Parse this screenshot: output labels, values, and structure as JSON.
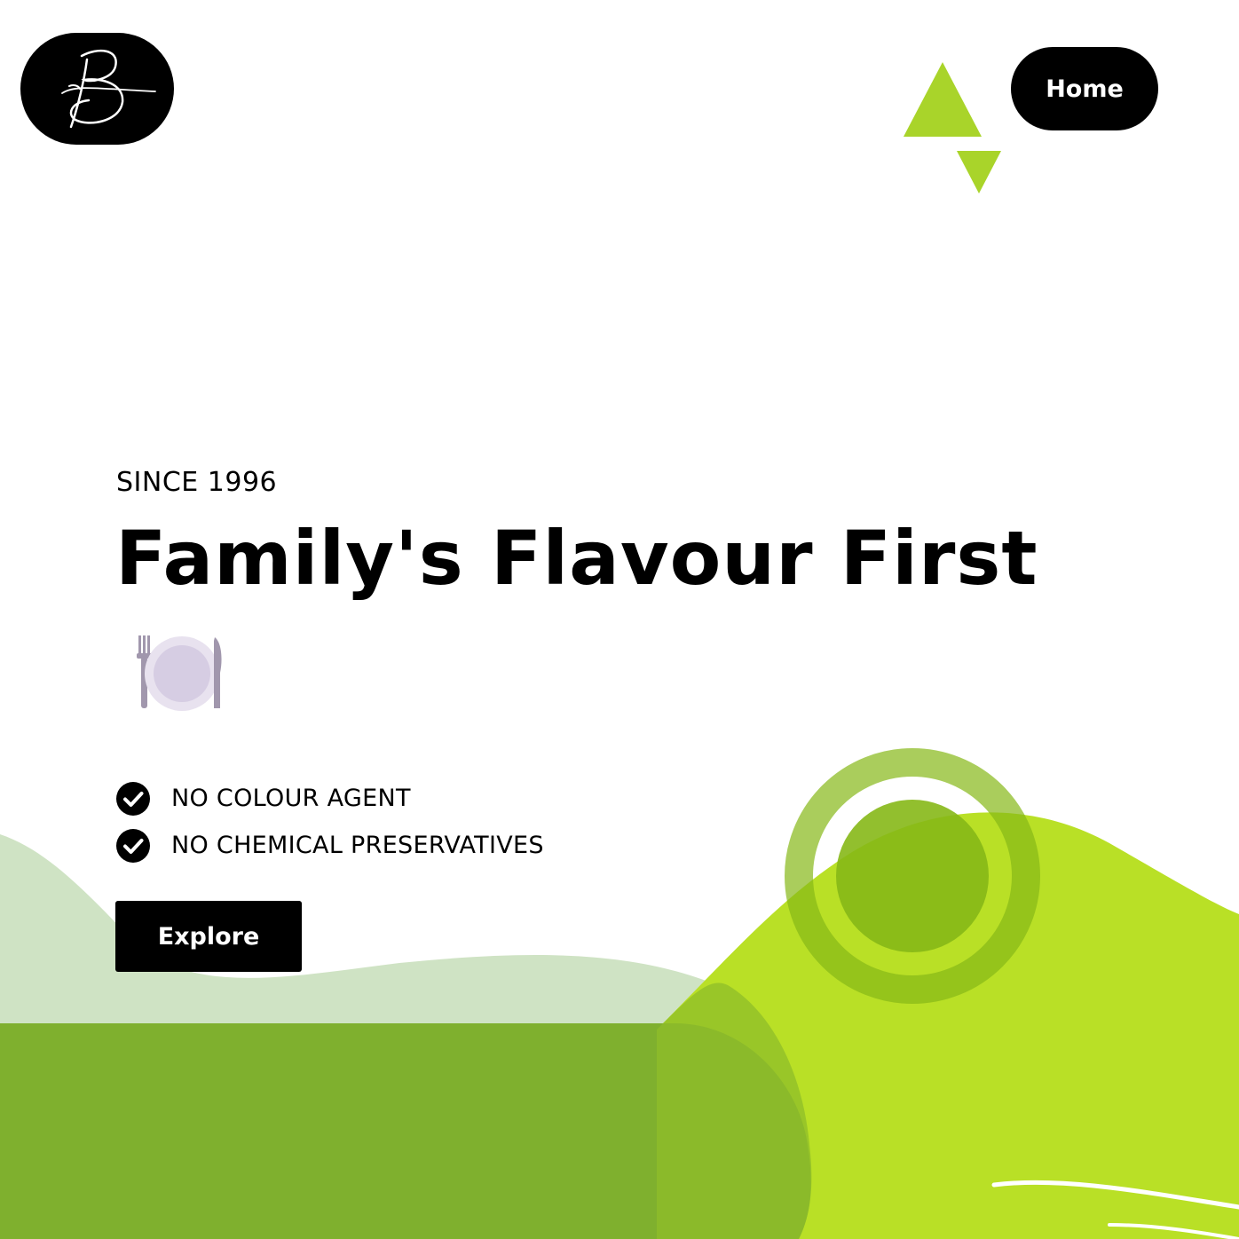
{
  "header": {
    "logo_icon": "signature-b-logo",
    "nav": {
      "home_label": "Home"
    },
    "decoration_icon": "green-triangles-icon"
  },
  "hero": {
    "eyebrow": "SINCE 1996",
    "title": "Family's Flavour First",
    "emoji_icon": "plate-fork-knife-icon",
    "features": [
      {
        "icon": "check-circle-icon",
        "label": "NO COLOUR AGENT"
      },
      {
        "icon": "check-circle-icon",
        "label": "NO CHEMICAL PRESERVATIVES"
      }
    ],
    "cta_label": "Explore"
  },
  "colors": {
    "accent_green": "#b9e026",
    "dark_green": "#7fb02e",
    "pale_green": "#cfe3c4",
    "circle_green": "#86b817",
    "text": "#000000",
    "background": "#ffffff"
  }
}
